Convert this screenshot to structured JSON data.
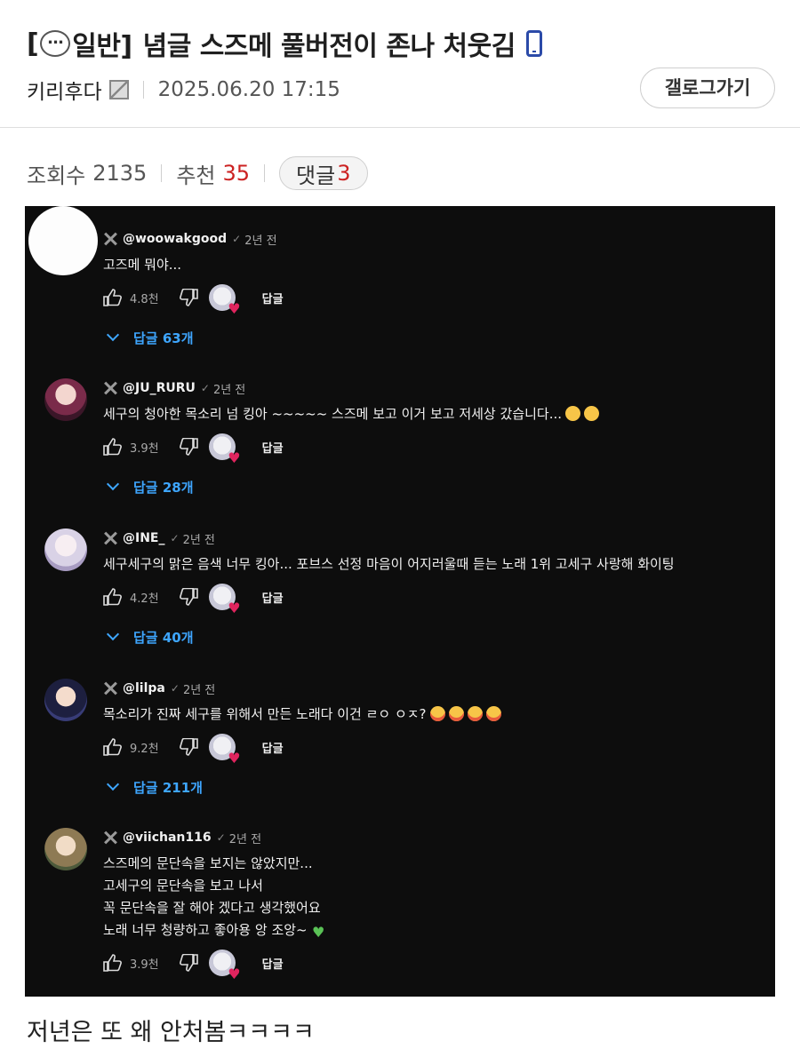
{
  "post": {
    "title_prefix": "[",
    "title_category": "일반]",
    "title_text": "념글 스즈메 풀버전이 존나 처웃김",
    "author": "키리후다",
    "date": "2025.06.20 17:15",
    "gallog_label": "갤로그가기"
  },
  "stats": {
    "views_label": "조회수",
    "views": "2135",
    "recommend_label": "추천",
    "recommend": "35",
    "comments_label": "댓글",
    "comments": "3"
  },
  "embed": {
    "reply_label": "답글",
    "comments": [
      {
        "handle": "@woowakgood",
        "ago": "2년 전",
        "lines": [
          "고즈메 뭐야..."
        ],
        "likes": "4.8천",
        "replies": "답글 63개"
      },
      {
        "handle": "@JU_RURU",
        "ago": "2년 전",
        "lines": [
          "세구의 청아한 목소리 넘 킹아 ~~~~~ 스즈메 보고 이거 보고 저세상 갔습니다..."
        ],
        "likes": "3.9천",
        "replies": "답글 28개"
      },
      {
        "handle": "@INE_",
        "ago": "2년 전",
        "lines": [
          "세구세구의 맑은 음색 너무 킹아... 포브스 선정 마음이 어지러울때 듣는 노래 1위 고세구 사랑해 화이팅"
        ],
        "likes": "4.2천",
        "replies": "답글 40개"
      },
      {
        "handle": "@lilpa",
        "ago": "2년 전",
        "lines": [
          "목소리가 진짜 세구를 위해서 만든 노래다 이건 ㄹㅇ ㅇㅈ?"
        ],
        "likes": "9.2천",
        "replies": "답글 211개"
      },
      {
        "handle": "@viichan116",
        "ago": "2년 전",
        "lines": [
          "스즈메의 문단속을 보지는 않았지만...",
          "고세구의 문단속을 보고 나서",
          "꼭 문단속을 잘 해야 겠다고 생각했어요",
          "노래 너무 청량하고 좋아용 앙 조앙~"
        ],
        "likes": "3.9천",
        "replies": ""
      }
    ]
  },
  "caption": "저년은 또 왜 안처봄ㅋㅋㅋㅋ",
  "colors": {
    "accent_red": "#cc2222",
    "yt_background": "#0d0d0d",
    "yt_link_blue": "#3ea6ff",
    "mobile_icon_blue": "#2b4aa8"
  },
  "icons": [
    "chat-bubble-icon",
    "mobile-icon",
    "member-icon",
    "close-x-icon",
    "verified-check-icon",
    "thumb-up-icon",
    "thumb-down-icon",
    "creator-heart-icon",
    "chevron-down-icon"
  ]
}
